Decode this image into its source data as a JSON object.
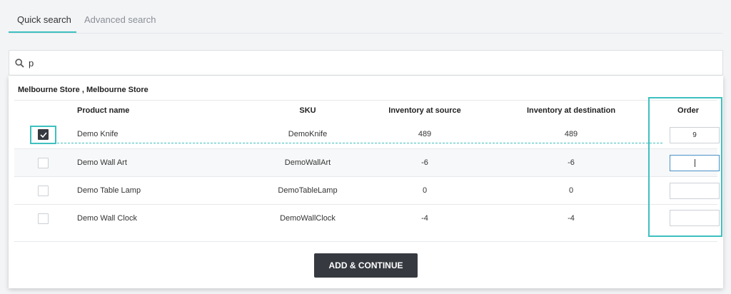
{
  "tabs": [
    {
      "label": "Quick search",
      "active": true
    },
    {
      "label": "Advanced search",
      "active": false
    }
  ],
  "search": {
    "icon": "search-icon",
    "value": "p"
  },
  "store_title": "Melbourne Store , Melbourne Store",
  "table": {
    "headers": [
      "Product name",
      "SKU",
      "Inventory at source",
      "Inventory at destination",
      "Order"
    ],
    "rows": [
      {
        "checked": true,
        "name": "Demo Knife",
        "sku": "DemoKnife",
        "source": "489",
        "destination": "489",
        "order": "9",
        "focused": false
      },
      {
        "checked": false,
        "name": "Demo Wall Art",
        "sku": "DemoWallArt",
        "source": "-6",
        "destination": "-6",
        "order": "",
        "focused": true
      },
      {
        "checked": false,
        "name": "Demo Table Lamp",
        "sku": "DemoTableLamp",
        "source": "0",
        "destination": "0",
        "order": "",
        "focused": false
      },
      {
        "checked": false,
        "name": "Demo Wall Clock",
        "sku": "DemoWallClock",
        "source": "-4",
        "destination": "-4",
        "order": "",
        "focused": false
      }
    ]
  },
  "add_button": {
    "label": "ADD & CONTINUE"
  },
  "colors": {
    "accent": "#3ec0c0",
    "button": "#363a40"
  }
}
